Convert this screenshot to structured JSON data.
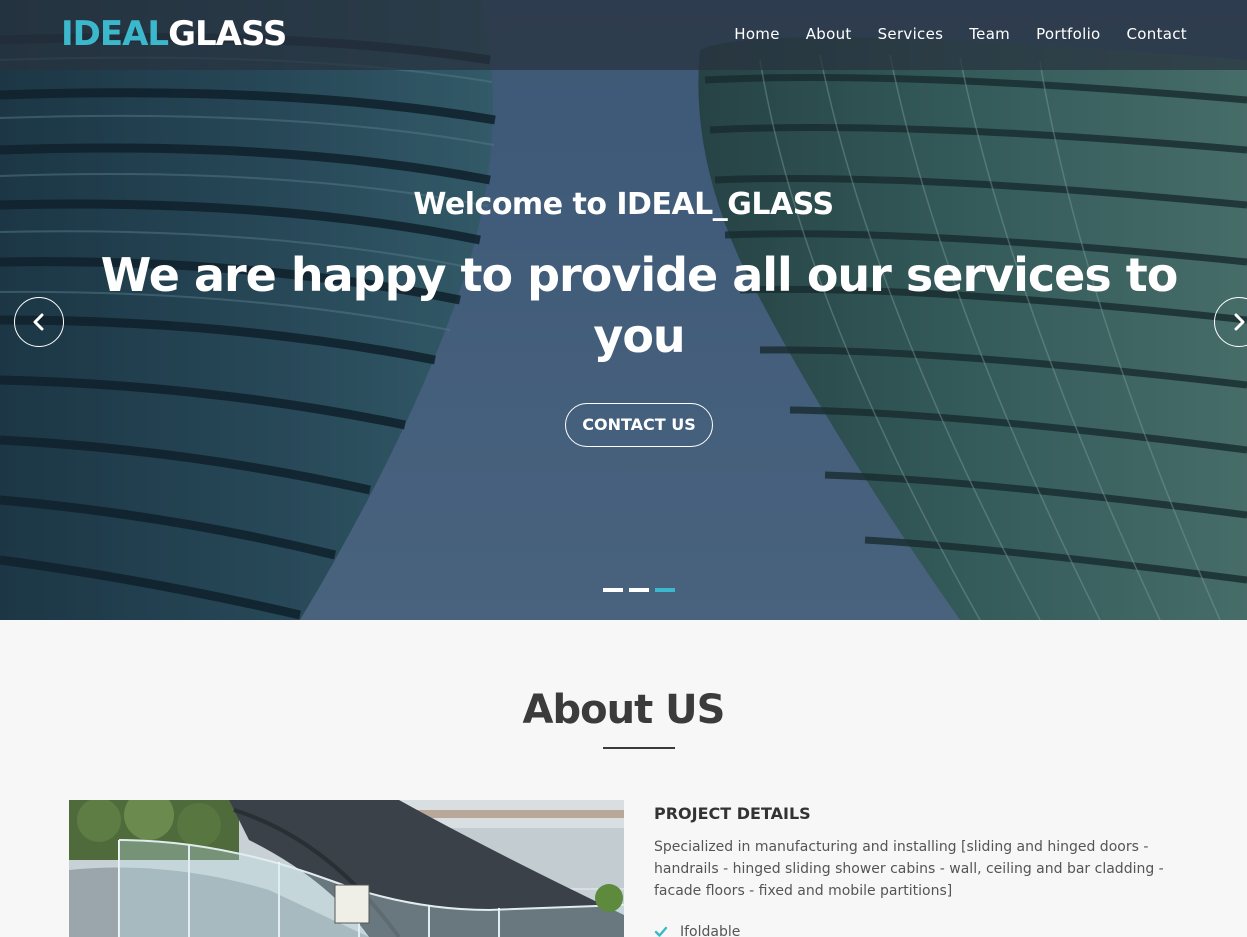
{
  "brand": {
    "logo_part1": "IDEAL",
    "logo_part2": "GLASS",
    "accent_color": "#3bb8cc"
  },
  "nav": {
    "items": [
      "Home",
      "About",
      "Services",
      "Team",
      "Portfolio",
      "Contact"
    ]
  },
  "hero": {
    "subtitle": "Welcome to IDEAL_GLASS",
    "title": "We are happy to provide all our services to you",
    "cta_label": "CONTACT US",
    "prev_icon": "chevron-left-icon",
    "next_icon": "chevron-right-icon",
    "slides_total": 3,
    "active_slide": 3
  },
  "about": {
    "title": "About US",
    "details_heading": "PROJECT DETAILS",
    "details_text": "Specialized in manufacturing and installing [sliding and hinged doors - handrails - hinged sliding shower cabins - wall, ceiling and bar cladding - facade floors - fixed and mobile partitions]",
    "features": [
      "Ifoldable"
    ],
    "feature_icon": "check-icon"
  }
}
